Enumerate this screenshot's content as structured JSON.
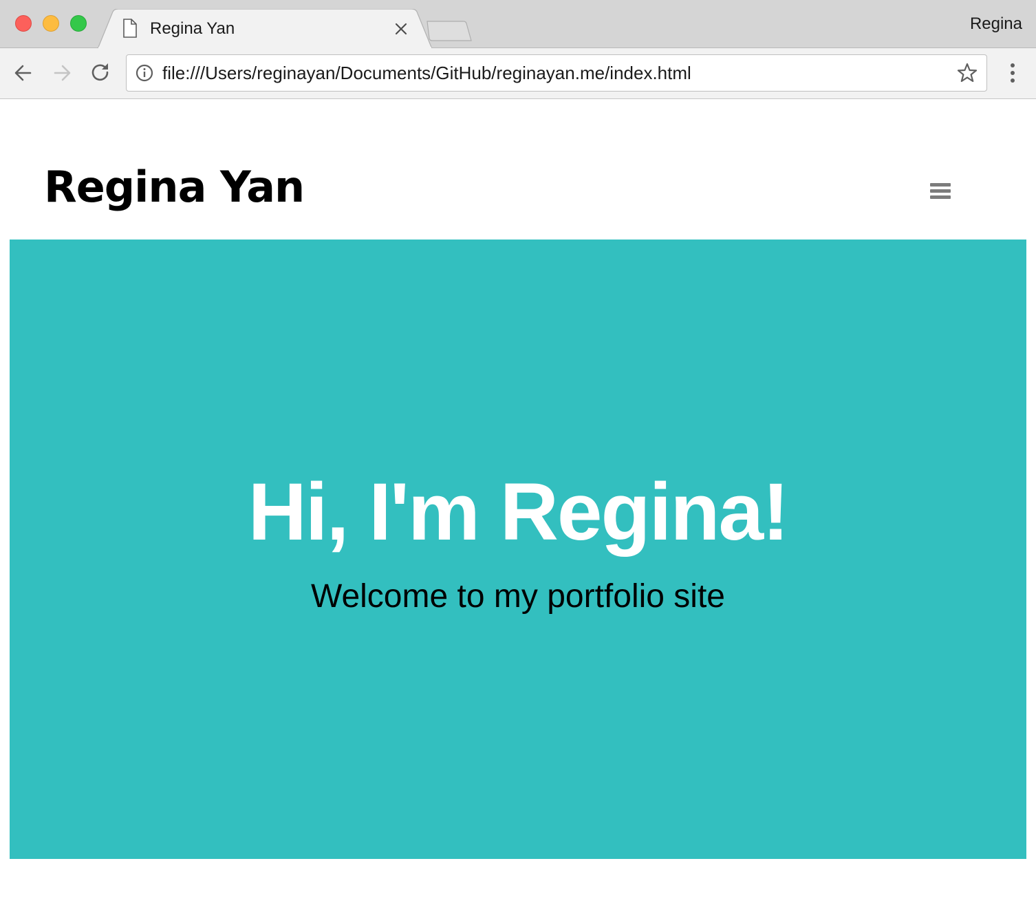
{
  "browser": {
    "tab": {
      "title": "Regina Yan",
      "icon": "file-icon",
      "close_icon": "close-icon"
    },
    "profile_name": "Regina",
    "toolbar": {
      "back_icon": "arrow-left-icon",
      "forward_icon": "arrow-right-icon",
      "reload_icon": "reload-icon",
      "url": "file:///Users/reginayan/Documents/GitHub/reginayan.me/index.html",
      "info_icon": "info-icon",
      "bookmark_icon": "star-icon",
      "menu_icon": "more-vertical-icon"
    }
  },
  "page": {
    "header": {
      "logo": "Regina Yan",
      "menu_icon": "hamburger-menu-icon"
    },
    "hero": {
      "title": "Hi, I'm Regina!",
      "subtitle": "Welcome to my portfolio site",
      "background_color": "#33bfbf"
    }
  }
}
